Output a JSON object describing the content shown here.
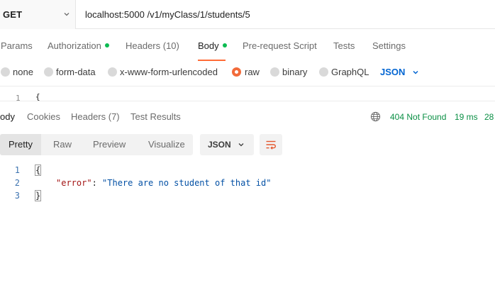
{
  "request": {
    "method": "GET",
    "url": "localhost:5000 /v1/myClass/1/students/5"
  },
  "request_tabs": [
    {
      "label": "Params",
      "dot": false,
      "active": false
    },
    {
      "label": "Authorization",
      "dot": true,
      "active": false
    },
    {
      "label": "Headers (10)",
      "dot": false,
      "active": false
    },
    {
      "label": "Body",
      "dot": true,
      "active": true
    },
    {
      "label": "Pre-request Script",
      "dot": false,
      "active": false
    },
    {
      "label": "Tests",
      "dot": false,
      "active": false
    },
    {
      "label": "Settings",
      "dot": false,
      "active": false
    }
  ],
  "body_types": [
    {
      "label": "none",
      "checked": false
    },
    {
      "label": "form-data",
      "checked": false
    },
    {
      "label": "x-www-form-urlencoded",
      "checked": false
    },
    {
      "label": "raw",
      "checked": true
    },
    {
      "label": "binary",
      "checked": false
    },
    {
      "label": "GraphQL",
      "checked": false
    }
  ],
  "raw_language": "JSON",
  "request_editor": {
    "line_number": "1",
    "content": "{"
  },
  "response_tabs": [
    {
      "label": "ody",
      "active": true
    },
    {
      "label": "Cookies",
      "active": false
    },
    {
      "label": "Headers (7)",
      "active": false
    },
    {
      "label": "Test Results",
      "active": false
    }
  ],
  "response_status": {
    "status": "404 Not Found",
    "time": "19 ms",
    "size": "28"
  },
  "format_tabs": [
    {
      "label": "Pretty",
      "active": true
    },
    {
      "label": "Raw",
      "active": false
    },
    {
      "label": "Preview",
      "active": false
    },
    {
      "label": "Visualize",
      "active": false
    }
  ],
  "response_language": "JSON",
  "response_body": {
    "lines": [
      "1",
      "2",
      "3"
    ],
    "open_brace": "{",
    "key": "\"error\"",
    "colon": ": ",
    "value": "\"There are no student of that id\"",
    "close_brace": "}"
  },
  "colors": {
    "accent_orange": "#ff6c37",
    "success_green": "#0cbb52",
    "status_green": "#0a8f44",
    "link_blue": "#0265d2"
  },
  "icons": [
    "chevron-down-icon",
    "globe-icon",
    "wrap-lines-icon"
  ]
}
